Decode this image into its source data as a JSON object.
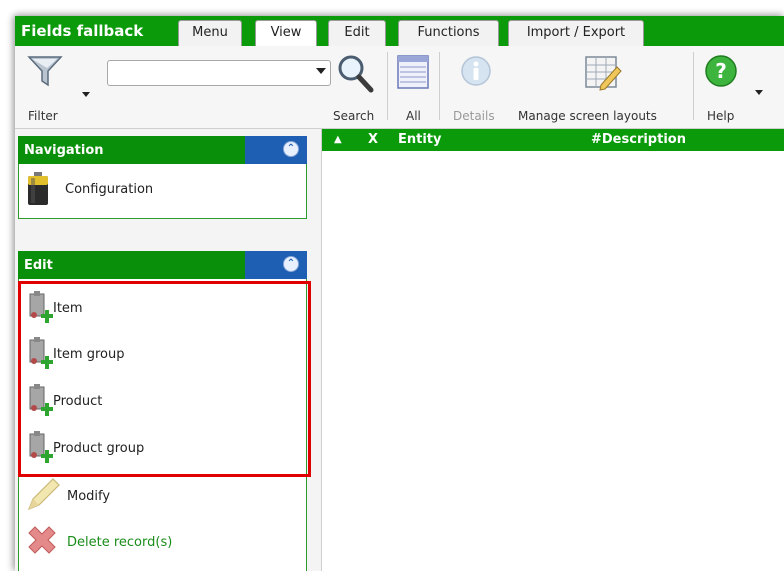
{
  "app": {
    "title": "Fields fallback"
  },
  "tabs": [
    {
      "label": "Menu"
    },
    {
      "label": "View"
    },
    {
      "label": "Edit"
    },
    {
      "label": "Functions"
    },
    {
      "label": "Import / Export"
    }
  ],
  "active_tab": "View",
  "toolbar": {
    "filter_label": "Filter",
    "search_value": "",
    "search_label": "Search",
    "all_label": "All",
    "details_label": "Details",
    "manage_label": "Manage screen layouts",
    "help_label": "Help"
  },
  "navigation": {
    "title": "Navigation",
    "items": [
      {
        "label": "Configuration",
        "icon": "battery-icon"
      }
    ]
  },
  "edit": {
    "title": "Edit",
    "items": [
      {
        "label": "Item",
        "icon": "add-record-icon"
      },
      {
        "label": "Item group",
        "icon": "add-record-icon"
      },
      {
        "label": "Product",
        "icon": "add-record-icon"
      },
      {
        "label": "Product group",
        "icon": "add-record-icon"
      },
      {
        "label": "Modify",
        "icon": "pencil-icon"
      },
      {
        "label": "Delete record(s)",
        "icon": "delete-icon"
      }
    ]
  },
  "grid": {
    "sort_indicator": "▲",
    "columns": [
      {
        "label": "X"
      },
      {
        "label": "Entity"
      },
      {
        "label": "#Description"
      }
    ]
  },
  "colors": {
    "brand_green": "#0a9a0a",
    "header_blue": "#1f5fb3",
    "highlight_red": "#e00000",
    "delete_green_text": "#1a8d1a"
  }
}
